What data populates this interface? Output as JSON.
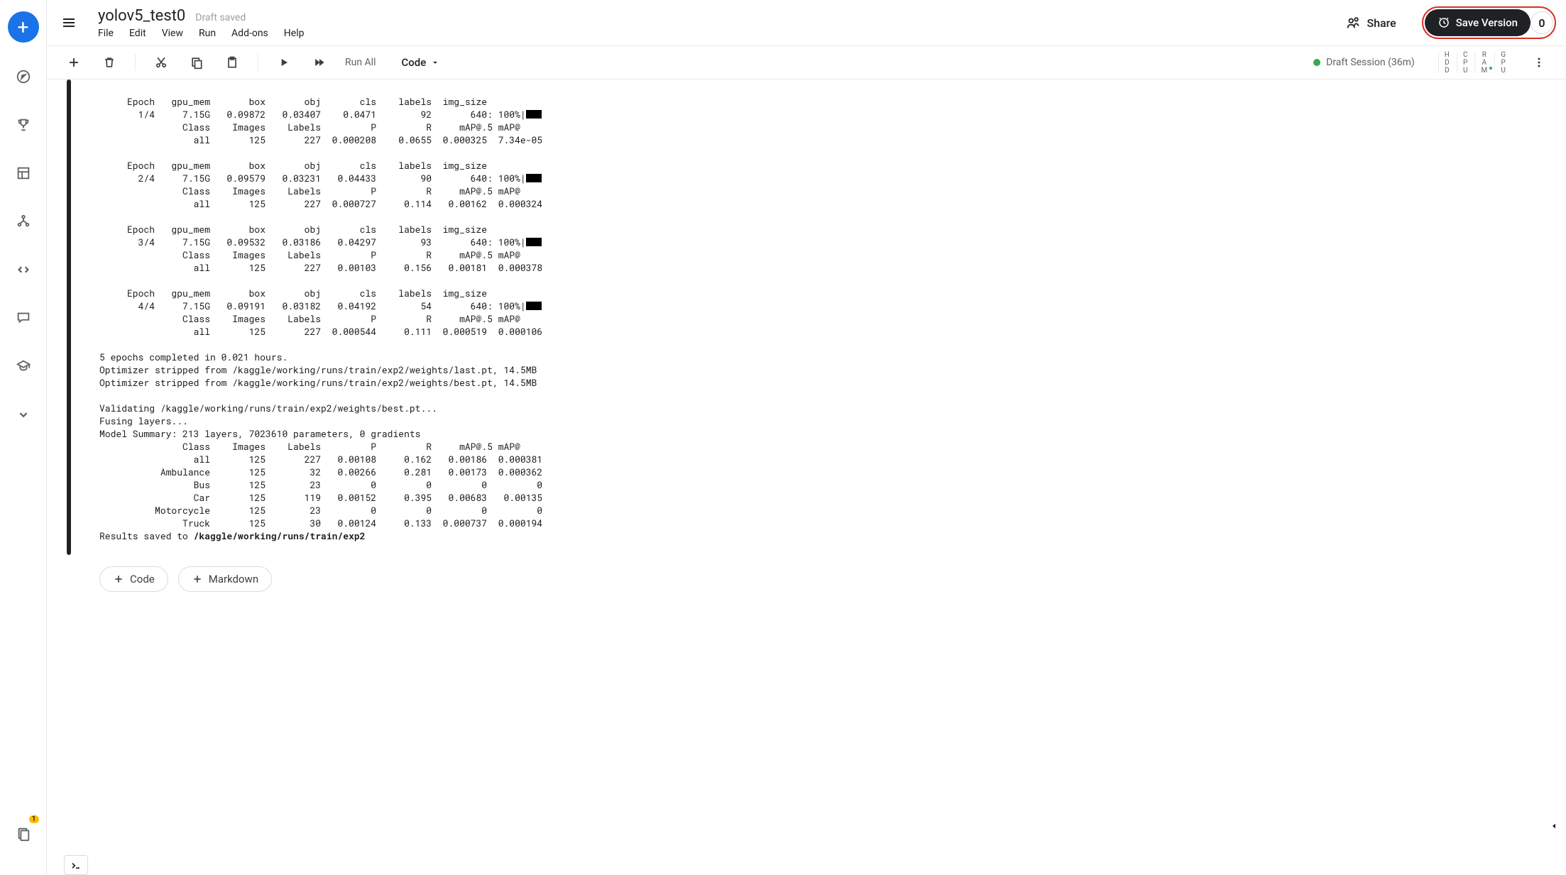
{
  "header": {
    "title": "yolov5_test0",
    "draft_saved": "Draft saved",
    "menu": {
      "file": "File",
      "edit": "Edit",
      "view": "View",
      "run": "Run",
      "addons": "Add-ons",
      "help": "Help"
    },
    "share": "Share",
    "save_version": "Save Version",
    "save_count": "0"
  },
  "toolbar": {
    "run_all": "Run All",
    "cell_type": "Code",
    "session": "Draft Session (36m)",
    "meters": {
      "hdd": "HDD",
      "cpu": "CPU",
      "ram": "RAM",
      "gpu": "GPU"
    }
  },
  "rail": {
    "badge": "1"
  },
  "add": {
    "code": "Code",
    "markdown": "Markdown"
  },
  "output": {
    "line00": "",
    "e1h": "     Epoch   gpu_mem       box       obj       cls    labels  img_size",
    "e1": "       1/4     7.15G   0.09872   0.03407    0.0471        92       640: 100%|",
    "ch1": "               Class    Images    Labels         P         R     mAP@.5 mAP@",
    "a1": "                 all       125       227  0.000208    0.0655  0.000325  7.34e-05",
    "sp1": "",
    "e2h": "     Epoch   gpu_mem       box       obj       cls    labels  img_size",
    "e2": "       2/4     7.15G   0.09579   0.03231   0.04433        90       640: 100%|",
    "ch2": "               Class    Images    Labels         P         R     mAP@.5 mAP@",
    "a2": "                 all       125       227  0.000727     0.114   0.00162  0.000324",
    "sp2": "",
    "e3h": "     Epoch   gpu_mem       box       obj       cls    labels  img_size",
    "e3": "       3/4     7.15G   0.09532   0.03186   0.04297        93       640: 100%|",
    "ch3": "               Class    Images    Labels         P         R     mAP@.5 mAP@",
    "a3": "                 all       125       227   0.00103     0.156   0.00181  0.000378",
    "sp3": "",
    "e4h": "     Epoch   gpu_mem       box       obj       cls    labels  img_size",
    "e4": "       4/4     7.15G   0.09191   0.03182   0.04192        54       640: 100%|",
    "ch4": "               Class    Images    Labels         P         R     mAP@.5 mAP@",
    "a4": "                 all       125       227  0.000544     0.111  0.000519  0.000106",
    "sp4": "",
    "done": "5 epochs completed in 0.021 hours.",
    "opt1": "Optimizer stripped from /kaggle/working/runs/train/exp2/weights/last.pt, 14.5MB",
    "opt2": "Optimizer stripped from /kaggle/working/runs/train/exp2/weights/best.pt, 14.5MB",
    "sp5": "",
    "val": "Validating /kaggle/working/runs/train/exp2/weights/best.pt...",
    "fus": "Fusing layers...",
    "mod": "Model Summary: 213 layers, 7023610 parameters, 0 gradients",
    "vh": "               Class    Images    Labels         P         R     mAP@.5 mAP@",
    "v0": "                 all       125       227   0.00108     0.162   0.00186  0.000381",
    "v1": "           Ambulance       125        32   0.00266     0.281   0.00173  0.000362",
    "v2": "                 Bus       125        23         0         0         0         0",
    "v3": "                 Car       125       119   0.00152     0.395   0.00683   0.00135",
    "v4": "          Motorcycle       125        23         0         0         0         0",
    "v5": "               Truck       125        30   0.00124     0.133  0.000737  0.000194",
    "res1": "Results saved to ",
    "res2": "/kaggle/working/runs/train/exp2"
  }
}
